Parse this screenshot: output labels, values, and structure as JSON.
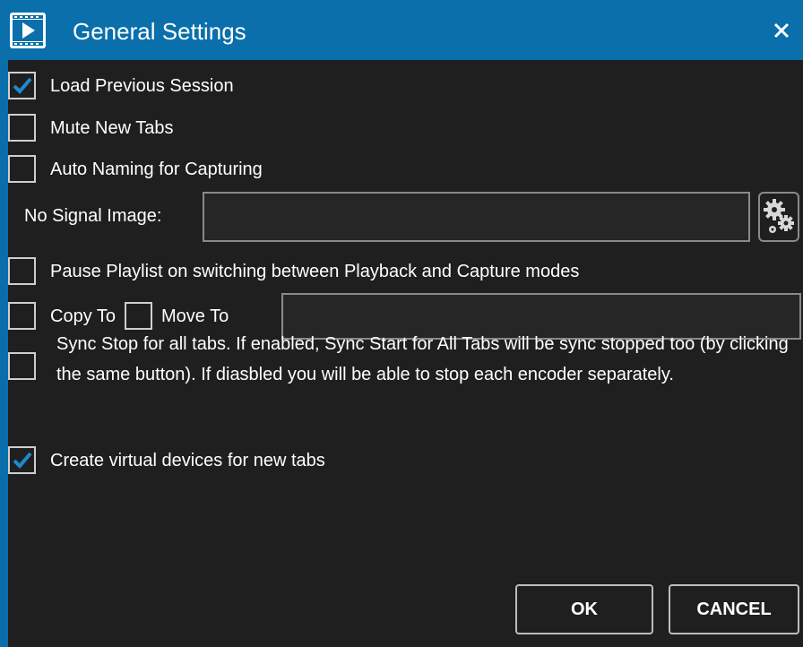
{
  "window": {
    "title": "General Settings",
    "app_icon": "video-app-icon",
    "close_icon": "close-icon"
  },
  "options": {
    "load_previous_session": {
      "label": "Load Previous Session",
      "checked": true
    },
    "mute_new_tabs": {
      "label": "Mute New Tabs",
      "checked": false
    },
    "auto_naming": {
      "label": "Auto Naming for Capturing",
      "checked": false
    },
    "no_signal_image": {
      "label": "No Signal Image:",
      "value": "",
      "button_icon": "gears-icon"
    },
    "pause_playlist": {
      "label": "Pause Playlist on switching between Playback and Capture modes",
      "checked": false
    },
    "copy_to": {
      "label": "Copy To",
      "checked": false
    },
    "move_to": {
      "label": "Move To",
      "checked": false,
      "path_value": ""
    },
    "sync_stop": {
      "label": "Sync Stop for all tabs. If enabled, Sync Start for All Tabs will be sync stopped too (by clicking the same button). If diasbled you will be able to stop each encoder separately.",
      "checked": false
    },
    "virtual_devices": {
      "label": "Create virtual devices for new tabs",
      "checked": true
    }
  },
  "buttons": {
    "ok": "OK",
    "cancel": "CANCEL"
  },
  "colors": {
    "title_bar": "#0a6fab",
    "content_bg": "#1f1f1f",
    "check_accent": "#1e88d0",
    "text": "#ffffff"
  }
}
